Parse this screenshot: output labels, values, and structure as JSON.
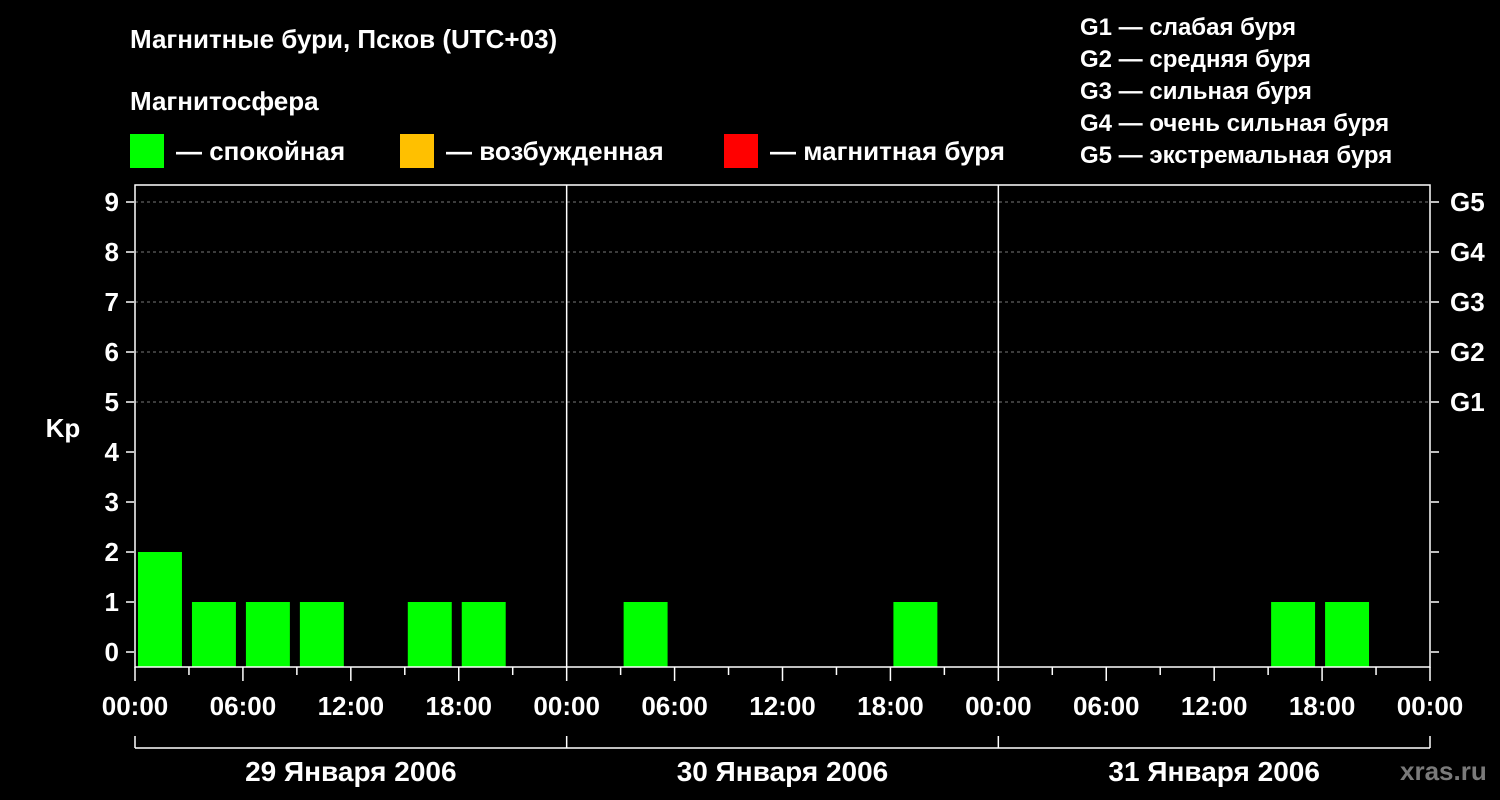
{
  "title": "Магнитные бури, Псков (UTC+03)",
  "subtitle": "Магнитосфера",
  "legend": [
    {
      "label": "— спокойная",
      "color": "#00ff00"
    },
    {
      "label": "— возбужденная",
      "color": "#ffc000"
    },
    {
      "label": "— магнитная буря",
      "color": "#ff0000"
    }
  ],
  "g_legend": [
    "G1 — слабая буря",
    "G2 — средняя буря",
    "G3 — сильная буря",
    "G4 — очень сильная буря",
    "G5 — экстремальная буря"
  ],
  "watermark": "xras.ru",
  "chart_data": {
    "type": "bar",
    "ylabel": "Kp",
    "ylim": [
      0,
      9
    ],
    "y_ticks": [
      "0",
      "1",
      "2",
      "3",
      "4",
      "5",
      "6",
      "7",
      "8",
      "9"
    ],
    "right_axis_labels": [
      {
        "kp": 5,
        "label": "G1"
      },
      {
        "kp": 6,
        "label": "G2"
      },
      {
        "kp": 7,
        "label": "G3"
      },
      {
        "kp": 8,
        "label": "G4"
      },
      {
        "kp": 9,
        "label": "G5"
      }
    ],
    "grid": "dashed horizontal at Kp 5–9",
    "x_tick_labels": [
      "00:00",
      "06:00",
      "12:00",
      "18:00",
      "00:00",
      "06:00",
      "12:00",
      "18:00",
      "00:00",
      "06:00",
      "12:00",
      "18:00",
      "00:00"
    ],
    "days": [
      "29 Января 2006",
      "30 Января 2006",
      "31 Января 2006"
    ],
    "interval_hours": 3,
    "series": [
      {
        "day": "29 Января 2006",
        "values": [
          2,
          1,
          1,
          1,
          0,
          1,
          1,
          0
        ]
      },
      {
        "day": "30 Января 2006",
        "values": [
          0,
          1,
          0,
          0,
          0,
          0,
          1,
          0
        ]
      },
      {
        "day": "31 Января 2006",
        "values": [
          0,
          0,
          0,
          0,
          0,
          1,
          1,
          0
        ]
      }
    ],
    "bar_color": "#00ff00"
  }
}
